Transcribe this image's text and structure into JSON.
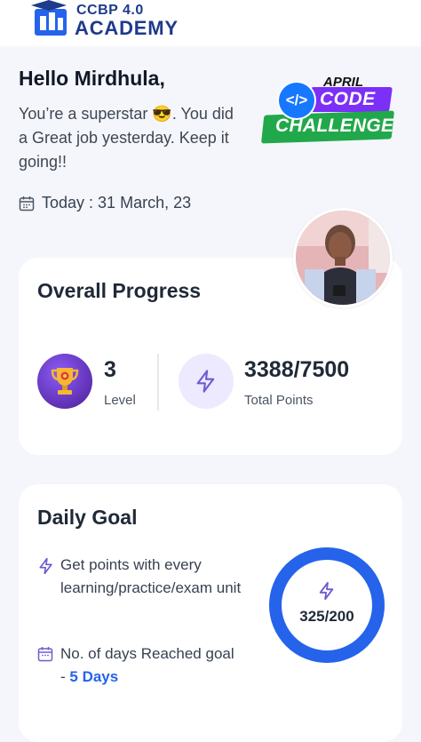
{
  "header": {
    "brand_line1": "CCBP 4.0",
    "brand_line2": "ACADEMY",
    "logo_icon": "graduation-cap-icon"
  },
  "greeting": {
    "title": "Hello Mirdhula,",
    "message": "You’re a superstar 😎. You did a Great job yesterday. Keep it going!!",
    "date_prefix": "Today : ",
    "date_value": "31 March, 23"
  },
  "challenge_badge": {
    "month": "APRIL",
    "code": "CODE",
    "challenge": "CHALLENGE",
    "icon": "code-brackets-icon"
  },
  "progress": {
    "title": "Overall Progress",
    "level_value": "3",
    "level_label": "Level",
    "points_value": "3388/7500",
    "points_label": "Total Points",
    "points_fraction": 0.4517
  },
  "daily_goal": {
    "title": "Daily Goal",
    "item1": "Get points with every learning/practice/exam unit",
    "item2_prefix": "No. of days Reached goal - ",
    "item2_value": "5 Days",
    "ring_value": "325/200",
    "ring_fraction": 1.0
  },
  "colors": {
    "brand_blue": "#1e3a8a",
    "accent_blue": "#2563eb",
    "purple": "#7b2ff7",
    "green": "#21a84a",
    "bolt": "#6d5bd0"
  }
}
